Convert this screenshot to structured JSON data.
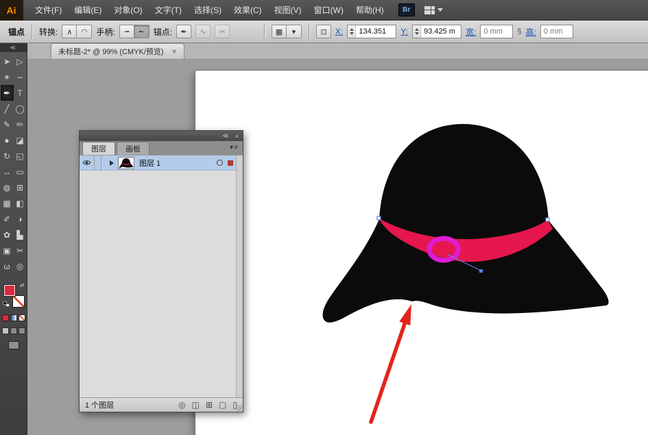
{
  "menu_bar": {
    "logo": "Ai",
    "items": [
      "文件(F)",
      "编辑(E)",
      "对象(O)",
      "文字(T)",
      "选择(S)",
      "效果(C)",
      "视图(V)",
      "窗口(W)",
      "帮助(H)"
    ],
    "bridge": "Br"
  },
  "control_bar": {
    "title": "锚点",
    "convert_label": "转换:",
    "convert_corner_glyph": "∧",
    "convert_smooth_glyph": "◠",
    "handles_label": "手柄:",
    "handle_show_glyph": "╼",
    "handle_hide_glyph": "╾",
    "anchor_label": "锚点:",
    "anchor_remove_glyph": "✒",
    "anchor_connect_glyph": "∿",
    "anchor_cut_glyph": "✂",
    "transform_menu_glyph": "▦",
    "caret_glyph": "▾",
    "align_widget_glyph": "⊡",
    "x_label": "X:",
    "x_value": "134.351",
    "y_label": "Y:",
    "y_value": "93.425 m",
    "width_label": "宽:",
    "width_value": "0 mm",
    "link_glyph": "§",
    "height_label": "高:",
    "height_value": "0 mm"
  },
  "document_tab": {
    "title": "未标题-2* @ 99% (CMYK/预览)",
    "close": "×"
  },
  "toolbar": {
    "collapse_glyph": "≪",
    "swap_glyph": "⇄",
    "tools": [
      {
        "name": "selection",
        "glyph": "➤"
      },
      {
        "name": "direct-selection",
        "glyph": "▷"
      },
      {
        "name": "magic-wand",
        "glyph": "✶"
      },
      {
        "name": "lasso",
        "glyph": "∽"
      },
      {
        "name": "pen",
        "glyph": "✒",
        "selected": true
      },
      {
        "name": "type",
        "glyph": "T"
      },
      {
        "name": "line-segment",
        "glyph": "╱"
      },
      {
        "name": "ellipse",
        "glyph": "◯"
      },
      {
        "name": "paintbrush",
        "glyph": "✎"
      },
      {
        "name": "pencil",
        "glyph": "✏"
      },
      {
        "name": "blob-brush",
        "glyph": "●"
      },
      {
        "name": "eraser",
        "glyph": "◪"
      },
      {
        "name": "rotate",
        "glyph": "↻"
      },
      {
        "name": "scale",
        "glyph": "◱"
      },
      {
        "name": "width",
        "glyph": "↔"
      },
      {
        "name": "free-transform",
        "glyph": "▭"
      },
      {
        "name": "shape-builder",
        "glyph": "◍"
      },
      {
        "name": "perspective-grid",
        "glyph": "⊞"
      },
      {
        "name": "mesh",
        "glyph": "▦"
      },
      {
        "name": "gradient",
        "glyph": "◧"
      },
      {
        "name": "eyedropper",
        "glyph": "✐"
      },
      {
        "name": "blend",
        "glyph": "◑"
      },
      {
        "name": "symbol-sprayer",
        "glyph": "✿"
      },
      {
        "name": "column-graph",
        "glyph": "▙"
      },
      {
        "name": "artboard",
        "glyph": "▣"
      },
      {
        "name": "slice",
        "glyph": "✂"
      },
      {
        "name": "hand",
        "glyph": "ω"
      },
      {
        "name": "zoom",
        "glyph": "◎"
      }
    ]
  },
  "layers_panel": {
    "collapse_glyph": "≪",
    "close_glyph": "×",
    "menu_glyph": "▾≡",
    "tab_layers": "图层",
    "tab_artboards": "画板",
    "layer_name": "图层 1",
    "status": "1 个图层",
    "bottom_icons": [
      {
        "name": "locate-object",
        "glyph": "◎"
      },
      {
        "name": "make-clipping-mask",
        "glyph": "◫"
      },
      {
        "name": "new-sublayer",
        "glyph": "⊞"
      },
      {
        "name": "new-layer",
        "glyph": "▢"
      },
      {
        "name": "delete-layer",
        "glyph": "▯"
      }
    ]
  },
  "canvas": {
    "zoom": "99%",
    "color_mode": "CMYK",
    "colors": {
      "hat": "#0b0b0b",
      "band": "#e5174d",
      "circle_stroke": "#df1cd4",
      "arrow": "#e2231a",
      "anchor_blue": "#5b82d8",
      "fill_swatch": "#e0263a"
    }
  }
}
